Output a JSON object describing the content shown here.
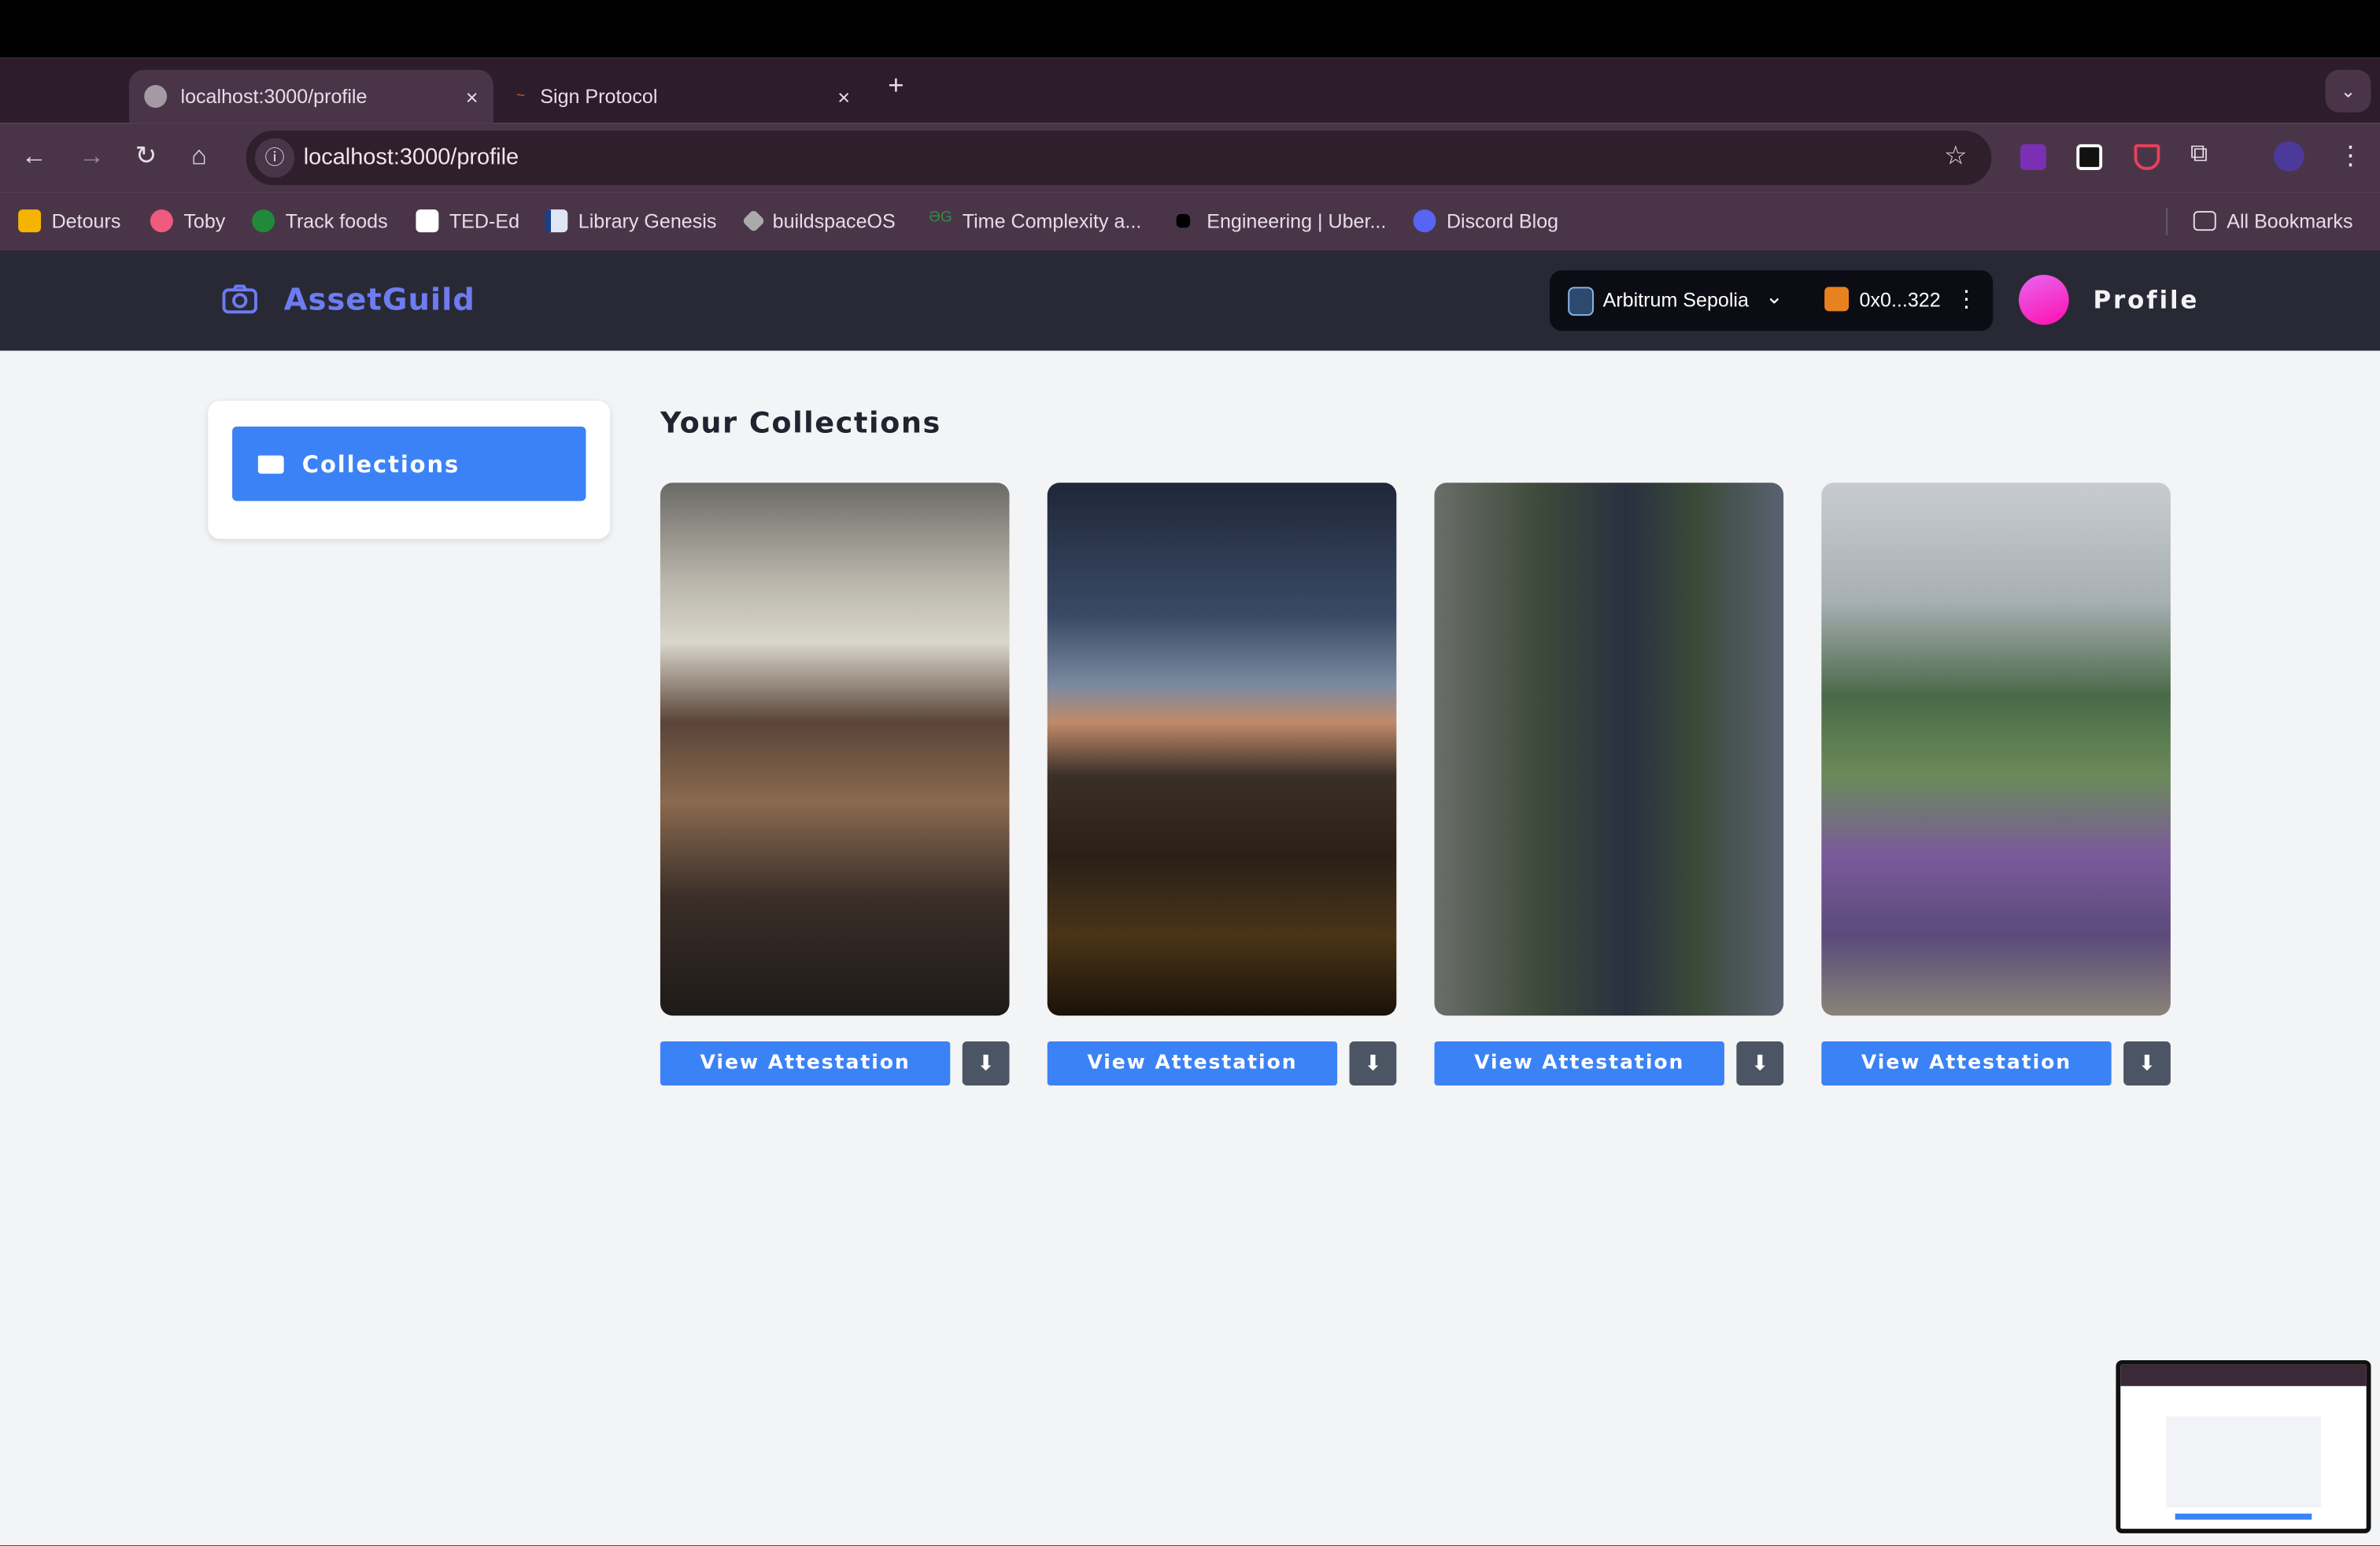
{
  "browser": {
    "tabs": [
      {
        "title": "localhost:3000/profile",
        "active": true
      },
      {
        "title": "Sign Protocol",
        "active": false
      }
    ],
    "close_glyph": "×",
    "new_tab_glyph": "+",
    "url": "localhost:3000/profile",
    "bookmarks": [
      {
        "label": "Detours",
        "color": "#f5b400"
      },
      {
        "label": "Toby",
        "color": "#f05a7e"
      },
      {
        "label": "Track foods",
        "color": "#1f8a3a"
      },
      {
        "label": "TED-Ed",
        "color": "#ffffff"
      },
      {
        "label": "Library Genesis",
        "color": "#1c3f8a"
      },
      {
        "label": "buildspaceOS",
        "color": "#aaaaaa"
      },
      {
        "label": "Time Complexity a...",
        "color": "#2f8d46"
      },
      {
        "label": "Engineering | Uber...",
        "color": "#000000"
      },
      {
        "label": "Discord Blog",
        "color": "#5865f2"
      }
    ],
    "all_bookmarks": "All Bookmarks"
  },
  "app": {
    "name": "AssetGuild",
    "network": "Arbitrum Sepolia",
    "address": "0x0...322",
    "profile_label": "Profile",
    "accent": "#3b82f6"
  },
  "sidebar": {
    "items": [
      {
        "label": "Collections",
        "icon": "folder-icon",
        "active": true
      }
    ]
  },
  "main": {
    "title": "Your Collections",
    "collections": [
      {
        "image": "restaurant interior",
        "button": "View Attestation"
      },
      {
        "image": "night city on hills at dusk",
        "button": "View Attestation"
      },
      {
        "image": "floral arch walkway",
        "button": "View Attestation"
      },
      {
        "image": "flower elephant sculpture in dome garden",
        "button": "View Attestation"
      }
    ]
  }
}
